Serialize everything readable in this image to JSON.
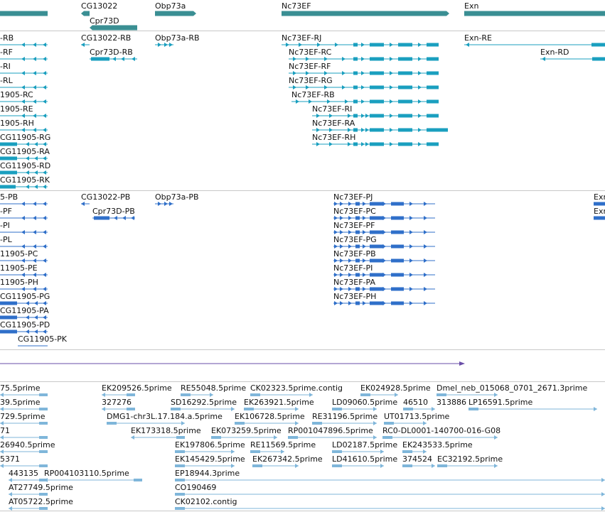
{
  "colors": {
    "gene": "#3a8f93",
    "transcript": "#1a9fbf",
    "protein": "#2f6fc9",
    "contig": "#6a4ea8",
    "est": "#7fb6da",
    "divider": "#c8c8c8"
  },
  "gene_track": {
    "labels": [
      "CG13022",
      "Cpr73D",
      "Obp73a",
      "Nc73EF",
      "Exn"
    ]
  },
  "transcript_track": {
    "labels": [
      "-RB",
      "-RF",
      "-RI",
      "-RL",
      "1905-RC",
      "1905-RE",
      "1905-RH",
      "CG11905-RG",
      "CG11905-RA",
      "CG11905-RD",
      "CG11905-RK",
      "CG13022-RB",
      "Cpr73D-RB",
      "Obp73a-RB",
      "Nc73EF-RJ",
      "Nc73EF-RC",
      "Nc73EF-RF",
      "Nc73EF-RG",
      "Nc73EF-RB",
      "Nc73EF-RI",
      "Nc73EF-RA",
      "Nc73EF-RH",
      "Exn-RE",
      "Exn-RD"
    ]
  },
  "protein_track": {
    "labels": [
      "5-PB",
      "-PF",
      "-PI",
      "-PL",
      "11905-PC",
      "11905-PE",
      "11905-PH",
      "CG11905-PG",
      "CG11905-PA",
      "CG11905-PD",
      "CG11905-PK",
      "CG13022-PB",
      "Cpr73D-PB",
      "Obp73a-PB",
      "Nc73EF-PJ",
      "Nc73EF-PC",
      "Nc73EF-PF",
      "Nc73EF-PG",
      "Nc73EF-PB",
      "Nc73EF-PI",
      "Nc73EF-PA",
      "Nc73EF-PH",
      "Exn",
      "Exn"
    ]
  },
  "est_track": {
    "labels": [
      "75.5prime",
      "EK209526.5prime",
      "RE55048.5prime",
      "CK02323.5prime.contig",
      "EK024928.5prime",
      "Dmel_neb_015068_0701_2671.3prime",
      "39.5prime",
      "327276",
      "SD16292.5prime",
      "EK263921.5prime",
      "LD09060.5prime",
      "46510",
      "313886",
      "LP16591.5prime",
      "729.5prime",
      "DMG1-chr3L.17.184.a.5prime",
      "EK106728.5prime",
      "RE31196.5prime",
      "UT01713.5prime",
      "71",
      "EK173318.5prime",
      "EK073259.5prime",
      "RP001047896.5prime",
      "RC0-DL0001-140700-016-G08",
      "26940.5prime",
      "EK197806.5prime",
      "RE11569.5prime",
      "LD02187.5prime",
      "EK243533.5prime",
      "5371",
      "EK145429.5prime",
      "EK267342.5prime",
      "LD41610.5prime",
      "374524",
      "EC32192.5prime",
      "443135",
      "RP004103110.5prime",
      "EP18944.3prime",
      "AT27749.5prime",
      "CO190469",
      "AT05722.5prime",
      "CK02102.contig"
    ]
  }
}
